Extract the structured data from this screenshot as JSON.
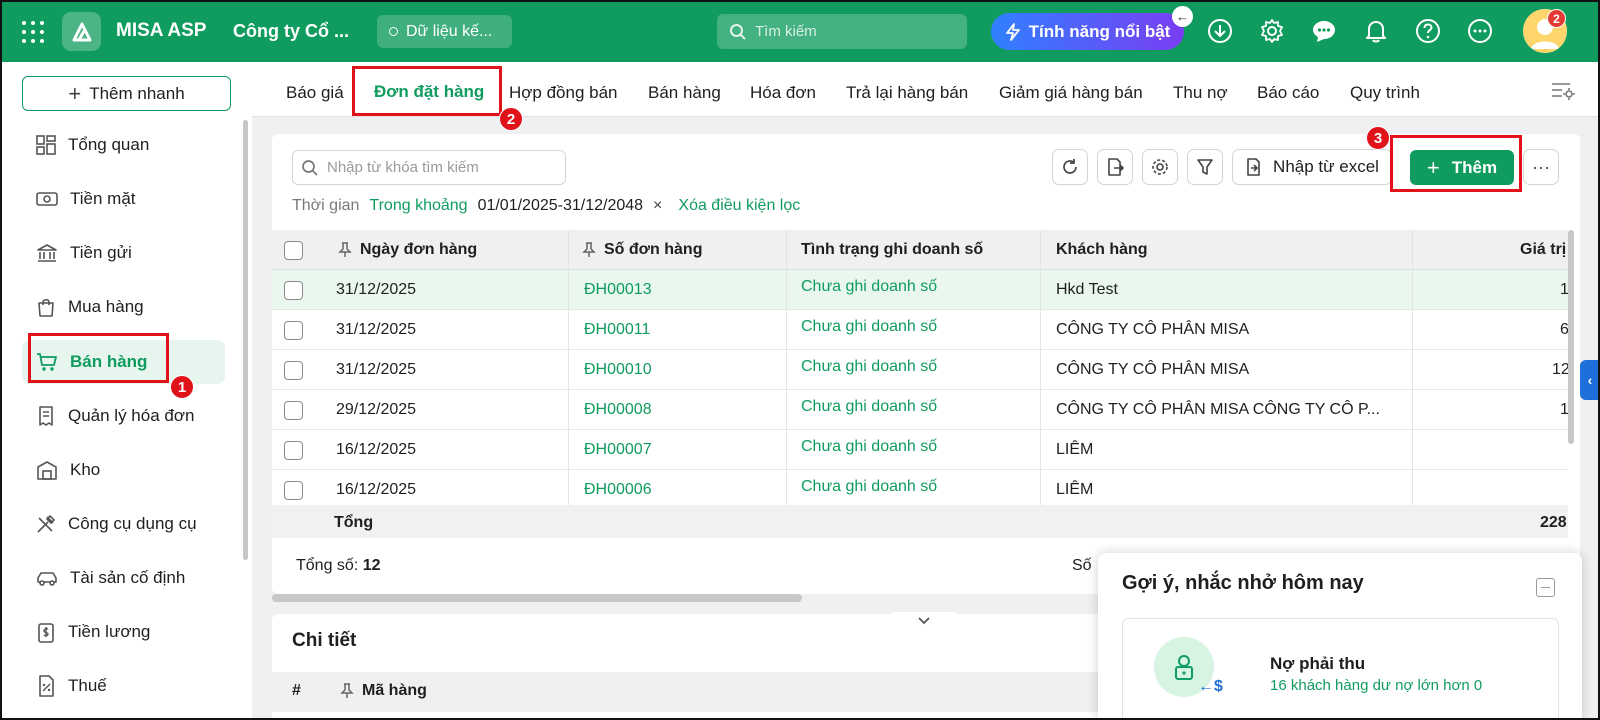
{
  "topbar": {
    "brand": "MISA ASP",
    "company": "Công ty Cổ ...",
    "data_pill": "Dữ liệu kế...",
    "search_placeholder": "Tìm kiếm",
    "feature_label": "Tính năng nổi bật",
    "avatar_badge": "2"
  },
  "sidebar": {
    "quick_add": "Thêm nhanh",
    "items": [
      {
        "label": "Tổng quan",
        "icon": "dashboard-icon"
      },
      {
        "label": "Tiền mặt",
        "icon": "cash-icon"
      },
      {
        "label": "Tiền gửi",
        "icon": "bank-icon"
      },
      {
        "label": "Mua hàng",
        "icon": "shopping-bag-icon"
      },
      {
        "label": "Bán hàng",
        "icon": "cart-icon"
      },
      {
        "label": "Quản lý hóa đơn",
        "icon": "receipt-icon"
      },
      {
        "label": "Kho",
        "icon": "warehouse-icon"
      },
      {
        "label": "Công cụ dụng cụ",
        "icon": "tools-icon"
      },
      {
        "label": "Tài sản cố định",
        "icon": "car-icon"
      },
      {
        "label": "Tiền lương",
        "icon": "salary-icon"
      },
      {
        "label": "Thuế",
        "icon": "tax-icon"
      }
    ]
  },
  "tabs": [
    "Báo giá",
    "Đơn đặt hàng",
    "Hợp đồng bán",
    "Bán hàng",
    "Hóa đơn",
    "Trả lại hàng bán",
    "Giảm giá hàng bán",
    "Thu nợ",
    "Báo cáo",
    "Quy trình"
  ],
  "toolbar": {
    "search_placeholder": "Nhập từ khóa tìm kiếm",
    "excel_label": "Nhập từ excel",
    "add_label": "Thêm",
    "more_label": "···"
  },
  "filter": {
    "label": "Thời gian",
    "mode": "Trong khoảng",
    "range": "01/01/2025-31/12/2048",
    "remove": "×",
    "clear": "Xóa điều kiện lọc"
  },
  "table": {
    "columns": [
      "Ngày đơn hàng",
      "Số đơn hàng",
      "Tình trạng ghi doanh số",
      "Khách hàng",
      "Giá trị"
    ],
    "rows": [
      {
        "date": "31/12/2025",
        "number": "ĐH00013",
        "status": "Chưa ghi doanh số",
        "customer": "Hkd Test",
        "value": "1"
      },
      {
        "date": "31/12/2025",
        "number": "ĐH00011",
        "status": "Chưa ghi doanh số",
        "customer": "CÔNG TY CÔ PHÂN MISA",
        "value": "6"
      },
      {
        "date": "31/12/2025",
        "number": "ĐH00010",
        "status": "Chưa ghi doanh số",
        "customer": "CÔNG TY CÔ PHÂN MISA",
        "value": "12"
      },
      {
        "date": "29/12/2025",
        "number": "ĐH00008",
        "status": "Chưa ghi doanh số",
        "customer": "CÔNG TY CÔ PHÂN MISA CÔNG TY CÔ P...",
        "value": "1"
      },
      {
        "date": "16/12/2025",
        "number": "ĐH00007",
        "status": "Chưa ghi doanh số",
        "customer": "LIÊM",
        "value": ""
      },
      {
        "date": "16/12/2025",
        "number": "ĐH00006",
        "status": "Chưa ghi doanh số",
        "customer": "LIÊM",
        "value": ""
      }
    ],
    "sum_label": "Tổng",
    "sum_value": "228",
    "total_label": "Tổng số:",
    "total_value": "12",
    "page_label": "Số"
  },
  "detail": {
    "title": "Chi tiết",
    "hash": "#",
    "column": "Mã hàng"
  },
  "suggest": {
    "title": "Gợi ý, nhắc nhở hôm nay",
    "card_title": "Nợ phải thu",
    "card_sub": "16 khách hàng dư nợ lớn hơn 0",
    "card_icon_glyph": "←$"
  },
  "annotations": {
    "step1": "1",
    "step2": "2",
    "step3": "3"
  },
  "colors": {
    "brand_green": "#109c5e",
    "highlight_red": "#e0131a",
    "accent_blue": "#1e6fd9"
  }
}
